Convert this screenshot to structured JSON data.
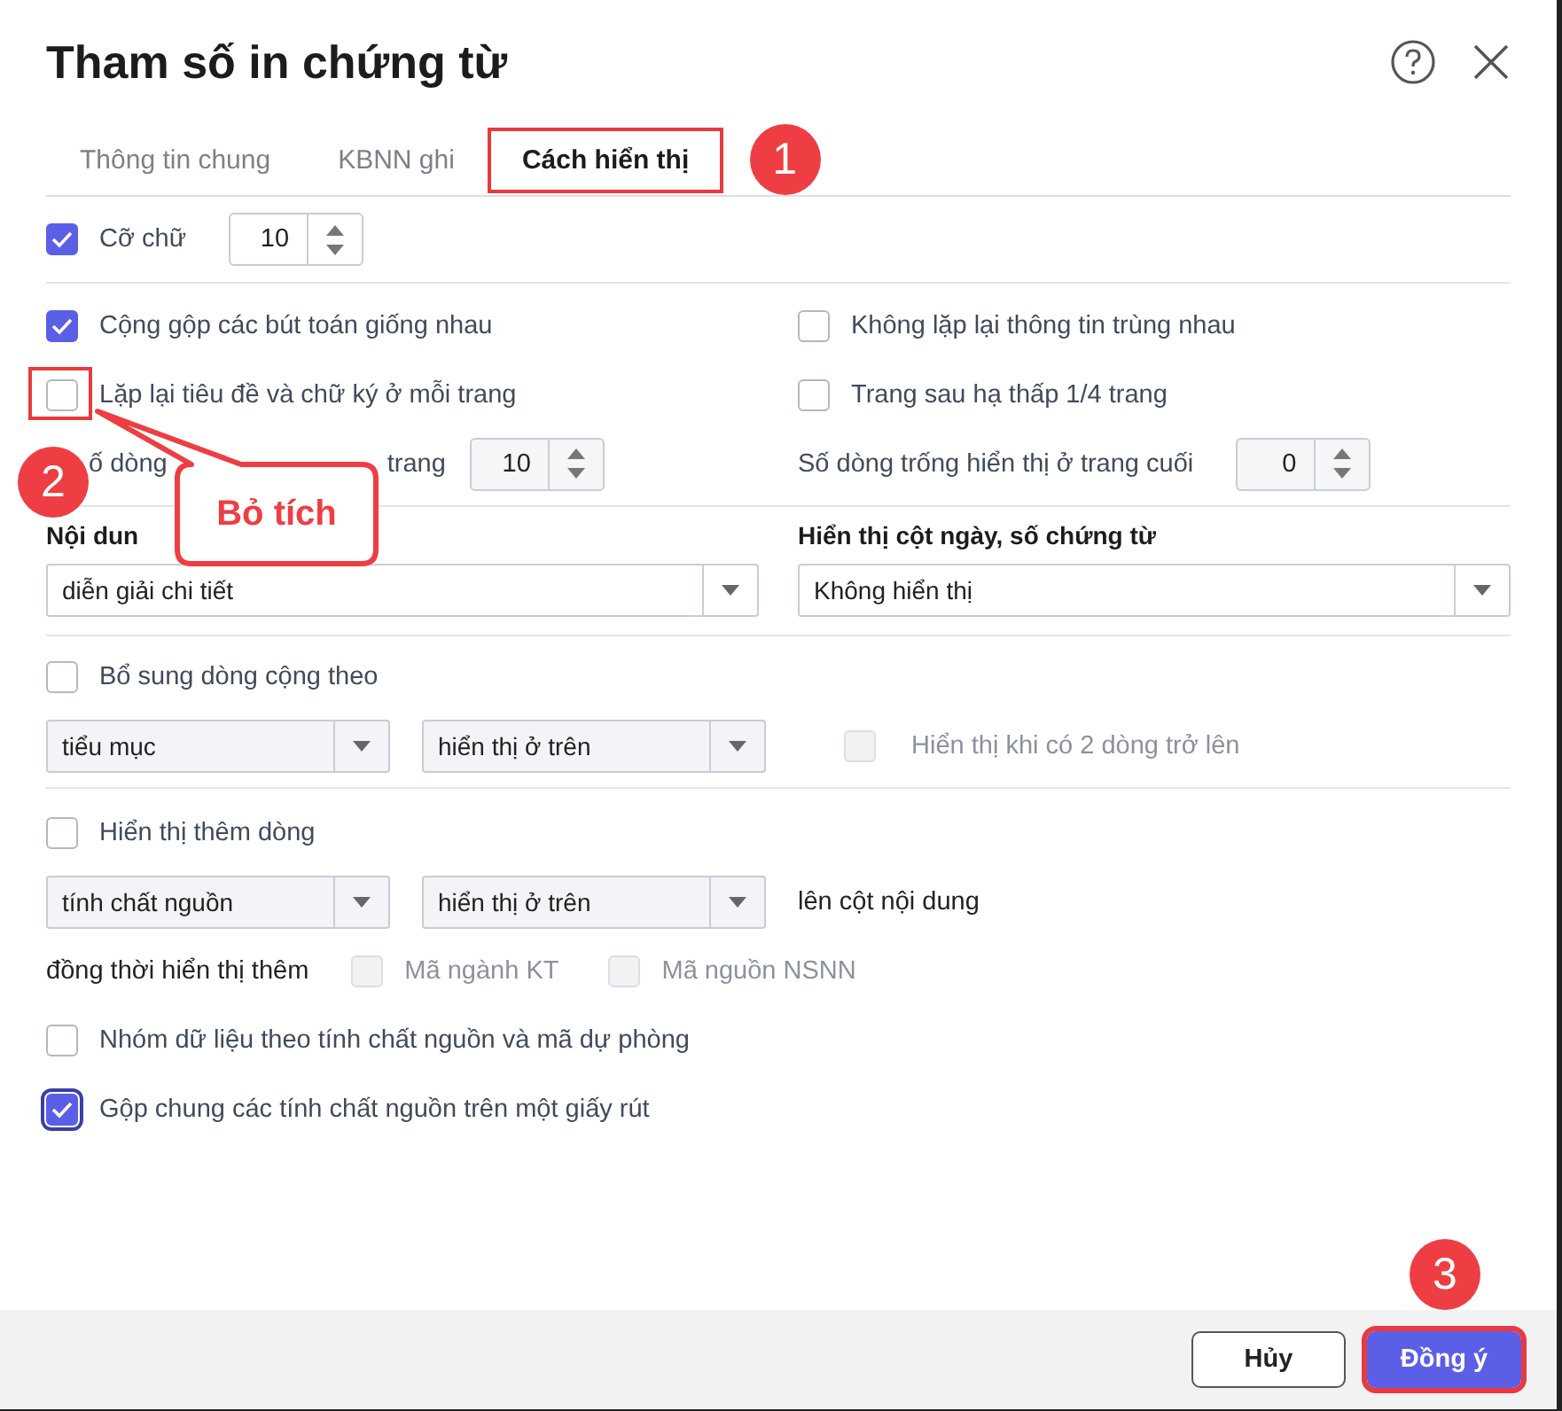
{
  "dialog": {
    "title": "Tham số in chứng từ"
  },
  "tabs": [
    {
      "label": "Thông tin chung",
      "selected": false,
      "highlighted": false
    },
    {
      "label": "KBNN ghi",
      "selected": false,
      "highlighted": false
    },
    {
      "label": "Cách hiển thị",
      "selected": true,
      "highlighted": true,
      "marker": "1"
    }
  ],
  "font_size": {
    "label": "Cỡ chữ",
    "checked": true,
    "value": "10"
  },
  "print_options": [
    {
      "label": "Cộng gộp các bút toán giống nhau",
      "checked": true,
      "highlighted": false
    },
    {
      "label": "Không lặp lại thông tin trùng nhau",
      "checked": false,
      "highlighted": false
    },
    {
      "label": "Lặp lại tiêu đề và chữ ký ở mỗi trang",
      "checked": false,
      "highlighted": true,
      "marker": "2",
      "callout": "Bỏ tích"
    },
    {
      "label": "Trang sau hạ thấp 1/4 trang",
      "checked": false,
      "highlighted": false
    }
  ],
  "rows_per_page": {
    "label_parts": [
      "ố dòng",
      "trang"
    ],
    "value": "10"
  },
  "blank_rows_last_page": {
    "label": "Số dòng trống hiển thị ở trang cuối",
    "value": "0"
  },
  "content": {
    "heading": "Nội dun",
    "value": "diễn giải chi tiết"
  },
  "date_column": {
    "heading": "Hiển thị cột ngày, số chứng từ",
    "value": "Không hiển thị"
  },
  "subtotal": {
    "label": "Bổ sung dòng cộng theo",
    "checked": false,
    "dropdowns": [
      "tiểu mục",
      "hiển thị ở trên"
    ],
    "condition": {
      "label": "Hiển thị khi có 2 dòng trở lên",
      "checked": false,
      "disabled": true
    }
  },
  "extra_line": {
    "label": "Hiển thị thêm dòng",
    "checked": false,
    "dropdowns": [
      "tính chất nguồn",
      "hiển thị ở trên"
    ],
    "suffix": "lên cột nội dung",
    "also_label": "đồng thời hiển thị thêm",
    "also_options": [
      {
        "label": "Mã ngành KT",
        "checked": false,
        "disabled": true
      },
      {
        "label": "Mã nguồn NSNN",
        "checked": false,
        "disabled": true
      }
    ]
  },
  "bottom_options": [
    {
      "label": "Nhóm dữ liệu theo tính chất nguồn và mã dự phòng",
      "checked": false,
      "focused": false
    },
    {
      "label": "Gộp chung các tính chất nguồn trên một giấy rút",
      "checked": true,
      "focused": true
    }
  ],
  "buttons": [
    {
      "label": "Hủy",
      "kind": "secondary",
      "highlighted": false
    },
    {
      "label": "Đồng ý",
      "kind": "primary",
      "highlighted": true,
      "marker": "3"
    }
  ]
}
